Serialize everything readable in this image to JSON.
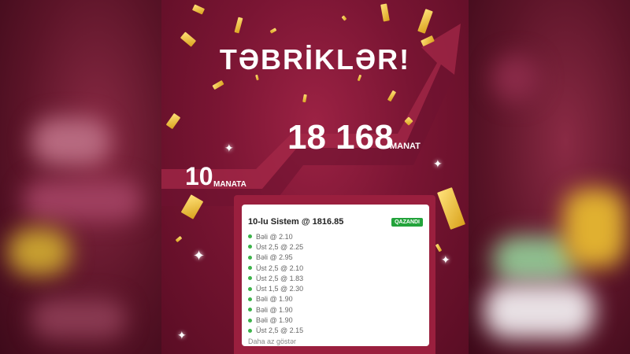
{
  "title": "TƏBRİKLƏR!",
  "win": {
    "amount": "18 168",
    "unit": "MANAT"
  },
  "stake": {
    "amount": "10",
    "unit": "MANATA"
  },
  "bet": {
    "name": "10-lu Sistem @ 1816.85",
    "status": "QAZANDI",
    "selections": [
      "Bəli @ 2.10",
      "Üst 2,5 @ 2.25",
      "Bəli @ 2.95",
      "Üst 2,5 @ 2.10",
      "Üst 2,5 @ 1.83",
      "Üst 1,5 @ 2.30",
      "Bəli @ 1.90",
      "Bəli @ 1.90",
      "Bəli @ 1.90",
      "Üst 2,5 @ 2.15"
    ],
    "toggle_label": "Daha az göstər"
  },
  "colors": {
    "background": "#7a1533",
    "accent_green": "#23a33b",
    "confetti_gold": "#e8b83a"
  },
  "icons": [
    "confetti",
    "sparkle-icon",
    "trend-arrow"
  ]
}
